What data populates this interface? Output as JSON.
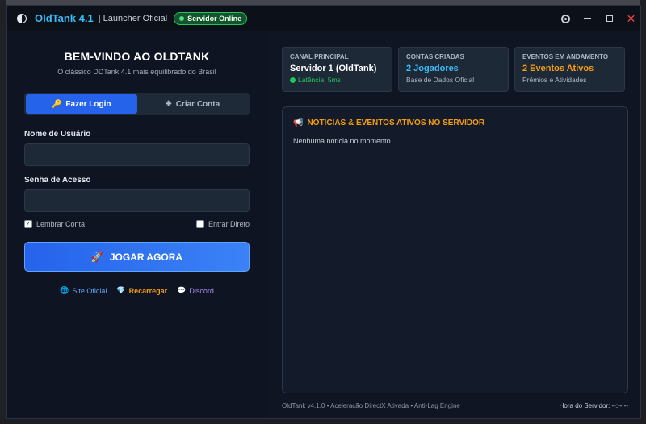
{
  "titlebar": {
    "app_name": "OldTank 4.1",
    "subtitle": "| Launcher Oficial",
    "status_badge": "Servidor Online",
    "controls": {
      "settings": "gear-icon",
      "minimize": "minimize-icon",
      "maximize": "maximize-icon",
      "close": "✕"
    }
  },
  "login": {
    "title": "BEM-VINDO AO OLDTANK",
    "subtitle": "O clássico DDTank 4.1 mais equilibrado do Brasil",
    "tabs": [
      {
        "label": "Fazer Login",
        "icon": "🔑",
        "active": true
      },
      {
        "label": "Criar Conta",
        "icon": "✚",
        "active": false
      }
    ],
    "username_label": "Nome de Usuário",
    "username_value": "",
    "password_label": "Senha de Acesso",
    "password_value": "",
    "remember_label": "Lembrar Conta",
    "remember_checked": true,
    "auto_login_label": "Entrar Direto",
    "auto_login_checked": false,
    "play_button": "JOGAR AGORA",
    "links": [
      {
        "label": "Site Oficial",
        "icon": "🌐",
        "color": "#60a5fa"
      },
      {
        "label": "Recarregar",
        "icon": "💎",
        "color": "#f59e0b"
      },
      {
        "label": "Discord",
        "icon": "💬",
        "color": "#a78bfa"
      }
    ]
  },
  "stats": [
    {
      "key": "CANAL PRINCIPAL",
      "value": "Servidor 1 (OldTank)",
      "sub": "Latência: 5ms",
      "value_color": "#ffffff",
      "sub_color": "#22c55e"
    },
    {
      "key": "CONTAS CRIADAS",
      "value": "2 Jogadores",
      "sub": "Base de Dados Oficial",
      "value_color": "#38bdf8",
      "sub_color": "#aeb7c6"
    },
    {
      "key": "EVENTOS EM ANDAMENTO",
      "value": "2 Eventos Ativos",
      "sub": "Prêmios e Atividades",
      "value_color": "#f59e0b",
      "sub_color": "#aeb7c6"
    }
  ],
  "news": {
    "title": "NOTÍCIAS & EVENTOS ATIVOS NO SERVIDOR",
    "empty": "Nenhuma notícia no momento."
  },
  "footer": {
    "version": "OldTank v4.1.0 • Aceleração DirectX Ativada • Anti-Lag Engine",
    "server_time": "Hora do Servidor: --:--:--"
  },
  "colors": {
    "accent": "#2563eb",
    "brand": "#38bdf8",
    "online": "#22c55e",
    "warning": "#f59e0b"
  }
}
